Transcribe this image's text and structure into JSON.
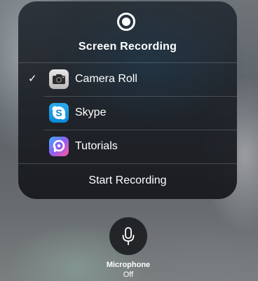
{
  "panel": {
    "title": "Screen Recording",
    "record_icon": "record-icon",
    "destinations": [
      {
        "label": "Camera Roll",
        "icon": "camera-roll-icon",
        "selected": true,
        "check_glyph": "✓"
      },
      {
        "label": "Skype",
        "icon": "skype-icon",
        "selected": false
      },
      {
        "label": "Tutorials",
        "icon": "tutorials-icon",
        "selected": false
      }
    ],
    "start_label": "Start Recording"
  },
  "microphone": {
    "icon": "microphone-icon",
    "title": "Microphone",
    "status": "Off"
  },
  "colors": {
    "text": "#ffffff",
    "panel": "#262b31",
    "skype": "#1a9be6"
  }
}
